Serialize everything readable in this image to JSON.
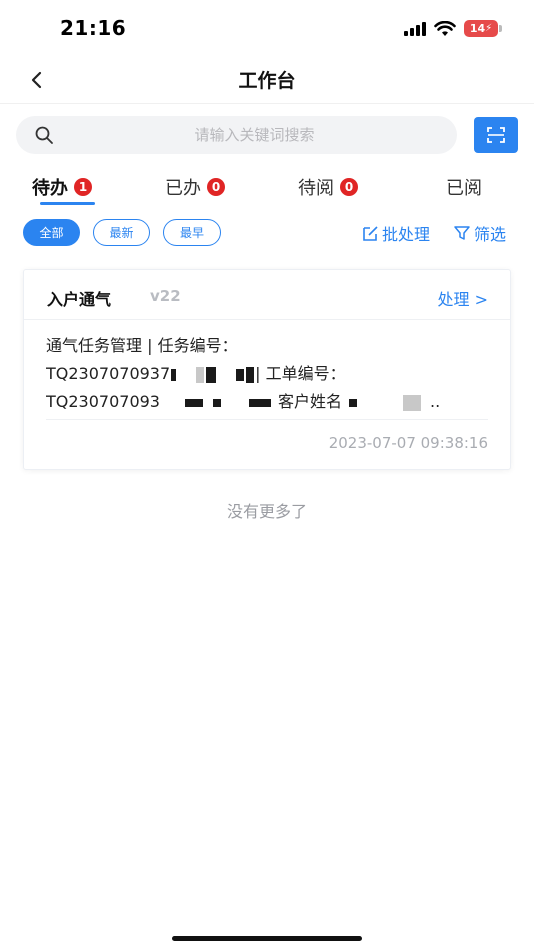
{
  "status_bar": {
    "time": "21:16",
    "battery_level": "14",
    "battery_color": "#e64a4a",
    "icons": [
      "signal-icon",
      "wifi-icon",
      "battery-charging-icon"
    ]
  },
  "nav": {
    "title": "工作台",
    "back_icon": "chevron-left-icon"
  },
  "search": {
    "placeholder": "请输入关键词搜索",
    "value": "",
    "scan_icon": "scan-icon"
  },
  "tabs": [
    {
      "label": "待办",
      "badge": "1",
      "active": true
    },
    {
      "label": "已办",
      "badge": "0",
      "active": false
    },
    {
      "label": "待阅",
      "badge": "0",
      "active": false
    },
    {
      "label": "已阅",
      "badge": "",
      "active": false
    }
  ],
  "filters": {
    "chips": [
      {
        "label": "全部",
        "active": true
      },
      {
        "label": "最新",
        "active": false
      },
      {
        "label": "最早",
        "active": false
      }
    ],
    "batch_label": "批处理",
    "filter_label": "筛选"
  },
  "card": {
    "title": "入户通气",
    "version": "v22",
    "action_label": "处理 >",
    "line1": "通气任务管理 | 任务编号：",
    "line2_prefix": "TQ2307070937",
    "line2_suffix": "| 工单编号：",
    "line3_prefix": "TQ230707093",
    "line3_middle": "客户姓名",
    "line3_suffix": "..",
    "timestamp": "2023-07-07 09:38:16"
  },
  "footer": {
    "no_more_text": "没有更多了"
  },
  "colors": {
    "accent": "#2b84f0",
    "badge": "#e02525",
    "muted": "#a9acb2"
  }
}
